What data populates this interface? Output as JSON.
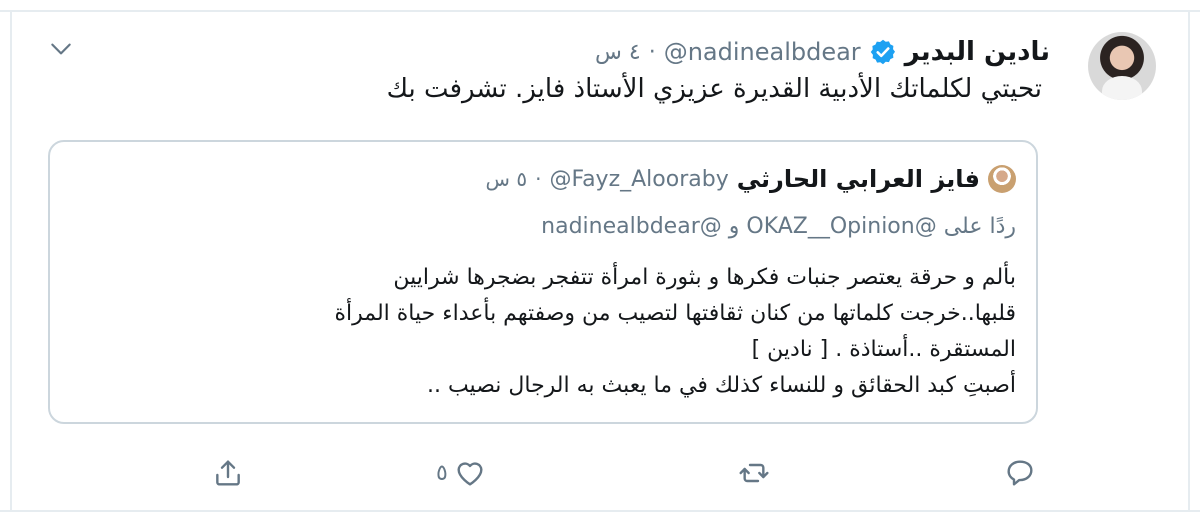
{
  "tweet": {
    "display_name": "نادين البدير",
    "handle": "@nadinealbdear",
    "dot": "·",
    "timestamp": "٤ س",
    "text": "تحيتي لكلماتك الأدبية القديرة عزيزي الأستاذ فايز. تشرفت بك",
    "icons": {
      "verified": "verified-badge-icon",
      "caret": "chevron-down-icon"
    }
  },
  "quoted": {
    "display_name": "فايز العرابي الحارثي",
    "handle": "@Fayz_Alooraby",
    "dot": "·",
    "timestamp": "٥ س",
    "reply_prefix": "ردًا على",
    "reply_mentions": "@OKAZ__Opinion و @nadinealbdear",
    "body_lines": [
      "بألم و حرقة يعتصر جنبات فكرها و بثورة امرأة تتفجر بضجرها شرايين",
      "قلبها..خرجت كلماتها من كنان ثقافتها لتصيب من وصفتهم بأعداء حياة المرأة",
      "المستقرة ..أستاذة . [ نادين ]",
      "أصبتِ كبد الحقائق و للنساء كذلك في ما يعبث به الرجال نصيب .."
    ]
  },
  "actions": {
    "reply_icon": "reply-icon",
    "retweet_icon": "retweet-icon",
    "like_icon": "heart-icon",
    "like_count": "٥",
    "share_icon": "share-icon"
  },
  "colors": {
    "primary_text": "#14171a",
    "secondary_text": "#657786",
    "border": "#ccd6dd",
    "accent": "#1da1f2"
  }
}
